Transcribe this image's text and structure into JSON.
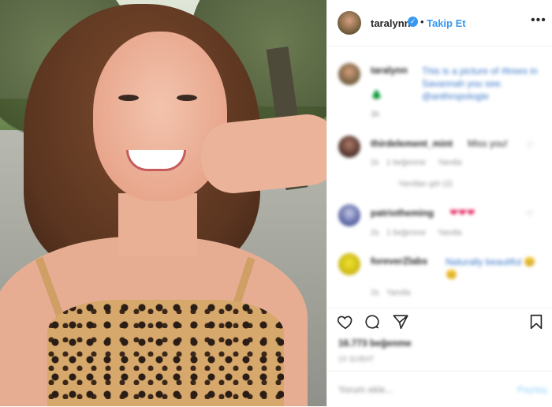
{
  "post": {
    "username": "taralynn",
    "separator": "•",
    "follow_label": "Takip Et",
    "more_label": "•••"
  },
  "caption": {
    "username": "taralynn",
    "text": "This is a picture of #trees in Savannah you see. @anthropologie",
    "emoji": "🌲",
    "meta": "3h"
  },
  "comments": [
    {
      "username": "thirdelement_mint",
      "text": "Miss you!",
      "meta_time": "2s",
      "meta_likes": "1 beğenme",
      "meta_reply": "Yanıtla",
      "replies": "Yanıtları gör (2)"
    },
    {
      "username": "patriotheming",
      "text": "❤❤❤",
      "meta_time": "2s",
      "meta_likes": "1 beğenme",
      "meta_reply": "Yanıtla"
    },
    {
      "username": "foreverZlabs",
      "text": "Naturally beautiful 😊😊",
      "meta_time": "2s",
      "meta_reply": "Yanıtla"
    }
  ],
  "likes_text": "16.773 beğenme",
  "date_text": "19 ŞUBAT",
  "add_comment": {
    "placeholder": "Yorum ekle...",
    "post_label": "Paylaş"
  },
  "icons": {
    "verified": "verified-badge-icon",
    "more": "more-options-icon",
    "heart": "heart-icon",
    "comment": "comment-icon",
    "share": "share-icon",
    "save": "bookmark-icon"
  },
  "colors": {
    "link": "#3897f0",
    "text": "#262626",
    "muted": "#8e8e8e",
    "border": "#efefef"
  }
}
